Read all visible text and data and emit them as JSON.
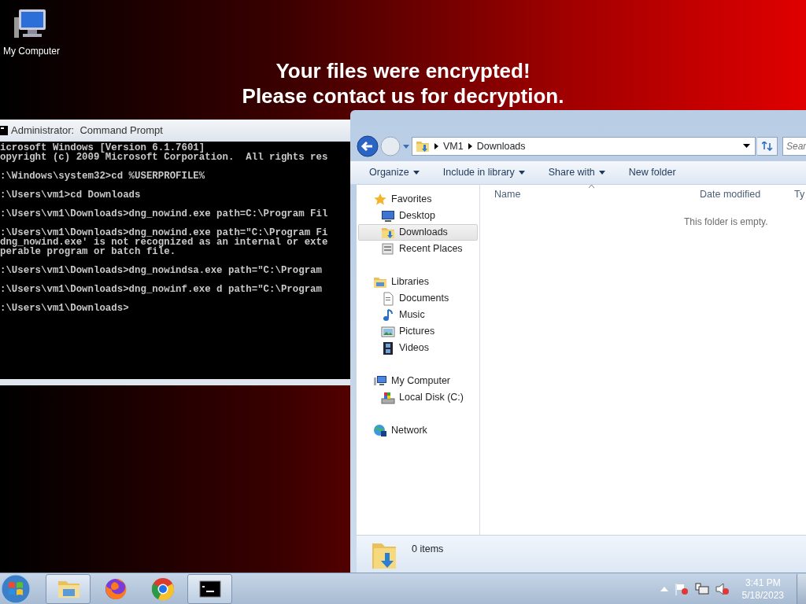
{
  "desktop": {
    "icons": [
      {
        "label": "My Computer"
      }
    ],
    "message": [
      "Your files were encrypted!",
      "Please contact us for decryption."
    ]
  },
  "cmd_window": {
    "title": "Administrator:  Command Prompt",
    "blocks": [
      [
        "icrosoft Windows [Version 6.1.7601]",
        "opyright (c) 2009 Microsoft Corporation.  All rights res"
      ],
      [
        ":\\Windows\\system32>cd %USERPROFILE%"
      ],
      [
        ":\\Users\\vm1>cd Downloads"
      ],
      [
        ":\\Users\\vm1\\Downloads>dng_nowind.exe path=C:\\Program Fil"
      ],
      [
        ":\\Users\\vm1\\Downloads>dng_nowind.exe path=\"C:\\Program Fi",
        "dng_nowind.exe' is not recognized as an internal or exte",
        "perable program or batch file."
      ],
      [
        ":\\Users\\vm1\\Downloads>dng_nowindsa.exe path=\"C:\\Program"
      ],
      [
        ":\\Users\\vm1\\Downloads>dng_nowinf.exe d path=\"C:\\Program"
      ],
      [
        ":\\Users\\vm1\\Downloads>"
      ]
    ]
  },
  "explorer": {
    "breadcrumb": [
      "VM1",
      "Downloads"
    ],
    "search": {
      "placeholder": "Sear"
    },
    "toolbar": [
      {
        "label": "Organize",
        "dropdown": true
      },
      {
        "label": "Include in library",
        "dropdown": true
      },
      {
        "label": "Share with",
        "dropdown": true
      },
      {
        "label": "New folder",
        "dropdown": false
      }
    ],
    "nav": [
      {
        "label": "Favorites",
        "kind": "star",
        "selected": false,
        "children": [
          {
            "label": "Desktop",
            "kind": "desktop",
            "selected": false
          },
          {
            "label": "Downloads",
            "kind": "downloads",
            "selected": true
          },
          {
            "label": "Recent Places",
            "kind": "recent",
            "selected": false
          }
        ]
      },
      {
        "label": "Libraries",
        "kind": "library",
        "selected": false,
        "children": [
          {
            "label": "Documents",
            "kind": "documents",
            "selected": false
          },
          {
            "label": "Music",
            "kind": "music",
            "selected": false
          },
          {
            "label": "Pictures",
            "kind": "pictures",
            "selected": false
          },
          {
            "label": "Videos",
            "kind": "videos",
            "selected": false
          }
        ]
      },
      {
        "label": "My Computer",
        "kind": "computer",
        "selected": false,
        "children": [
          {
            "label": "Local Disk (C:)",
            "kind": "disk",
            "selected": false
          }
        ]
      },
      {
        "label": "Network",
        "kind": "network",
        "selected": false
      }
    ],
    "columns": [
      "Name",
      "Date modified",
      "Ty"
    ],
    "empty_message": "This folder is empty.",
    "details": {
      "count": "0 items"
    }
  },
  "taskbar": {
    "buttons": [
      {
        "kind": "explorer",
        "running": true
      },
      {
        "kind": "firefox",
        "running": false
      },
      {
        "kind": "chrome",
        "running": false
      },
      {
        "kind": "cmd",
        "running": true
      }
    ],
    "clock": {
      "time": "3:41 PM",
      "date": "5/18/2023"
    }
  }
}
